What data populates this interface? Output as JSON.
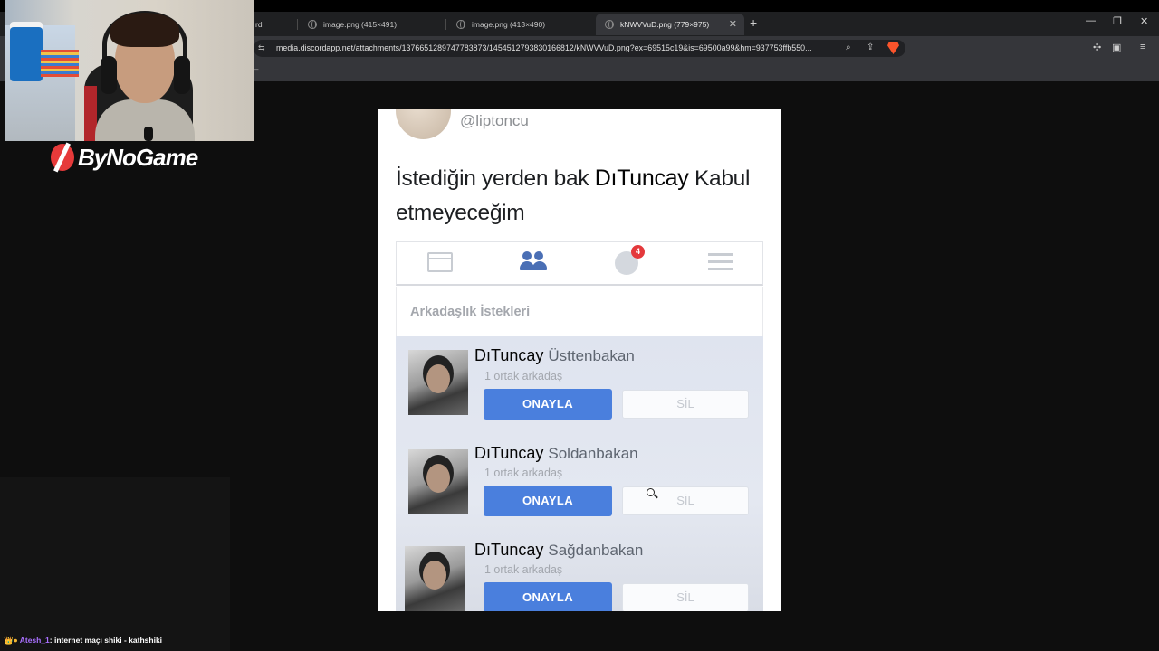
{
  "browser": {
    "tabs": [
      {
        "label": "rd",
        "active": false
      },
      {
        "label": "image.png (415×491)",
        "active": false
      },
      {
        "label": "image.png (413×490)",
        "active": false
      },
      {
        "label": "kNWVVuD.png (779×975)",
        "active": true
      }
    ],
    "new_tab": "+",
    "window_controls": {
      "minimize": "—",
      "restore": "❐",
      "close": "✕"
    },
    "url": "media.discordapp.net/attachments/1376651289747783873/1454512793830166812/kNWVVuD.png?ex=69515c19&is=69500a99&hm=937753ffb550...",
    "bookmark_placeholder": "–"
  },
  "post": {
    "handle": "@liptoncu",
    "text_before": "İstediğin yerden bak ",
    "name": "DıTuncay",
    "text_after": " Kabul etmeyeceğim"
  },
  "fb_nav": {
    "notification_count": "4"
  },
  "requests": {
    "header": "Arkadaşlık İstekleri",
    "items": [
      {
        "first": "DıTuncay",
        "last": "Üsttenbakan",
        "mutual": "1 ortak arkadaş",
        "confirm": "ONAYLA",
        "delete": "SİL"
      },
      {
        "first": "DıTuncay",
        "last": "Soldanbakan",
        "mutual": "1 ortak arkadaş",
        "confirm": "ONAYLA",
        "delete": "SİL"
      },
      {
        "first": "DıTuncay",
        "last": "Sağdanbakan",
        "mutual": "1 ortak arkadaş",
        "confirm": "ONAYLA",
        "delete": "SİL"
      }
    ]
  },
  "stream": {
    "brand": "ByNoGame",
    "chat": {
      "badges": "👑●",
      "user": "Atesh_1",
      "separator": ": ",
      "message": "internet maçı shiki - kathshiki"
    }
  },
  "colors": {
    "confirm_button": "#4a7fdd",
    "notification_badge": "#e4393c",
    "brand_red": "#e63a3a",
    "chat_username": "#a970ff"
  }
}
